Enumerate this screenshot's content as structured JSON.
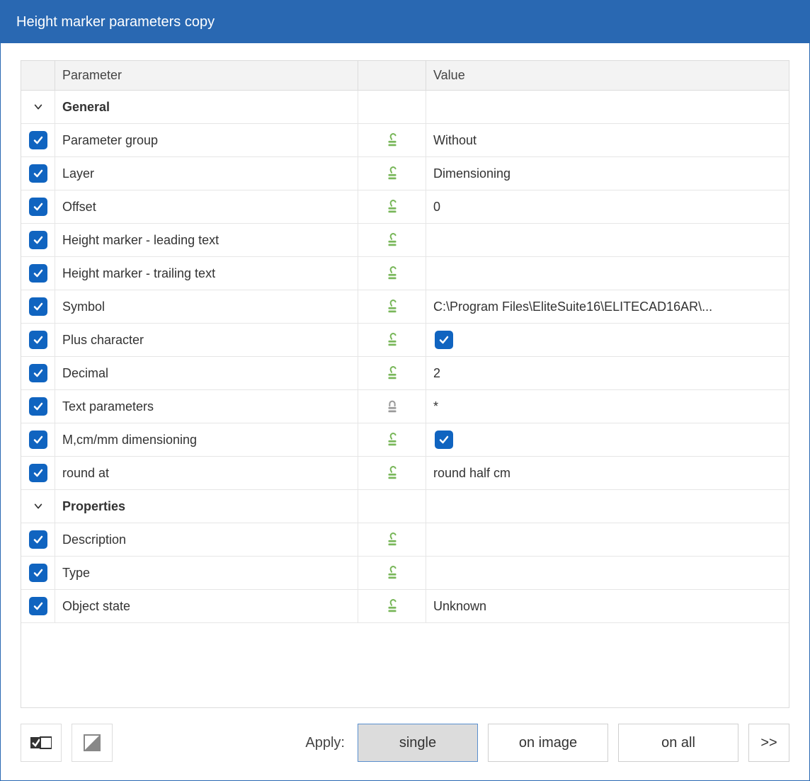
{
  "window": {
    "title": "Height marker parameters copy"
  },
  "headers": {
    "parameter": "Parameter",
    "value": "Value"
  },
  "groups": [
    {
      "name": "General",
      "rows": [
        {
          "checked": true,
          "label": "Parameter group",
          "lock": "unlocked",
          "valueType": "text",
          "value": "Without"
        },
        {
          "checked": true,
          "label": "Layer",
          "lock": "unlocked",
          "valueType": "text",
          "value": "Dimensioning"
        },
        {
          "checked": true,
          "label": "Offset",
          "lock": "unlocked",
          "valueType": "text",
          "value": "0"
        },
        {
          "checked": true,
          "label": "Height marker - leading text",
          "lock": "unlocked",
          "valueType": "text",
          "value": ""
        },
        {
          "checked": true,
          "label": "Height marker - trailing text",
          "lock": "unlocked",
          "valueType": "text",
          "value": ""
        },
        {
          "checked": true,
          "label": "Symbol",
          "lock": "unlocked",
          "valueType": "text",
          "value": "C:\\Program Files\\EliteSuite16\\ELITECAD16AR\\..."
        },
        {
          "checked": true,
          "label": "Plus character",
          "lock": "unlocked",
          "valueType": "bool",
          "boolValue": true
        },
        {
          "checked": true,
          "label": "Decimal",
          "lock": "unlocked",
          "valueType": "text",
          "value": "2"
        },
        {
          "checked": true,
          "label": "Text parameters",
          "lock": "locked",
          "valueType": "text",
          "value": "*"
        },
        {
          "checked": true,
          "label": "M,cm/mm dimensioning",
          "lock": "unlocked",
          "valueType": "bool",
          "boolValue": true
        },
        {
          "checked": true,
          "label": "round at",
          "lock": "unlocked",
          "valueType": "text",
          "value": "round half cm"
        }
      ]
    },
    {
      "name": "Properties",
      "rows": [
        {
          "checked": true,
          "label": "Description",
          "lock": "unlocked",
          "valueType": "text",
          "value": ""
        },
        {
          "checked": true,
          "label": "Type",
          "lock": "unlocked",
          "valueType": "text",
          "value": ""
        },
        {
          "checked": true,
          "label": "Object state",
          "lock": "unlocked",
          "valueType": "text",
          "value": "Unknown"
        }
      ]
    }
  ],
  "footer": {
    "applyLabel": "Apply:",
    "buttons": {
      "single": "single",
      "onImage": "on image",
      "onAll": "on all",
      "more": ">>"
    }
  }
}
